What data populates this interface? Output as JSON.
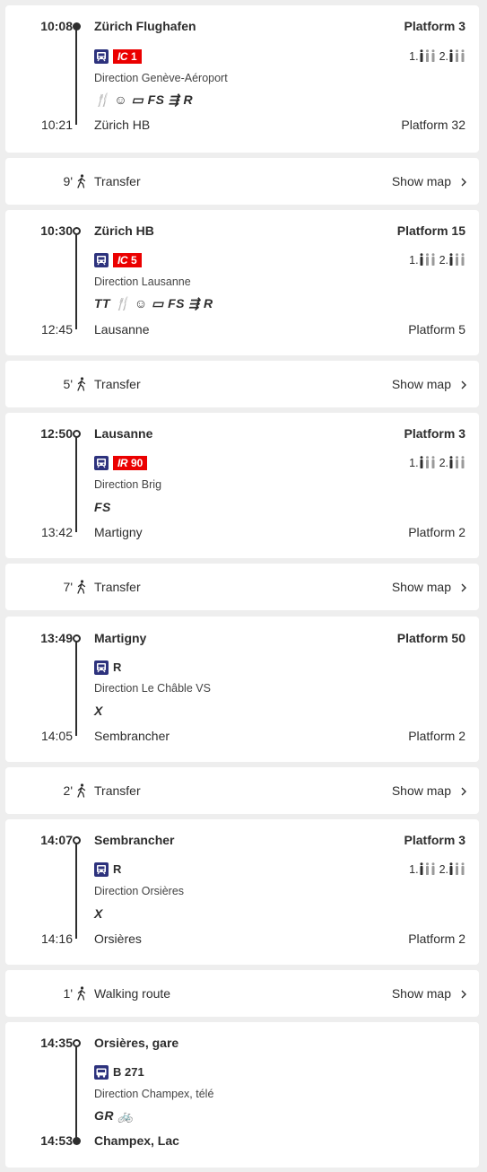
{
  "legs": [
    {
      "dep_time": "10:08",
      "dep_stop": "Zürich Flughafen",
      "dep_platform": "Platform 3",
      "line_prefix": "IC",
      "line_number": "1",
      "line_type": "red-badge",
      "occupancy": {
        "first": "1.",
        "second": "2."
      },
      "direction": "Direction Genève-Aéroport",
      "services": "🍴 ☺ ▭ FS ⇶ R",
      "arr_time": "10:21",
      "arr_stop": "Zürich HB",
      "arr_platform": "Platform 32"
    },
    {
      "dep_time": "10:30",
      "dep_stop": "Zürich HB",
      "dep_platform": "Platform 15",
      "line_prefix": "IC",
      "line_number": "5",
      "line_type": "red-badge",
      "occupancy": {
        "first": "1.",
        "second": "2."
      },
      "direction": "Direction Lausanne",
      "services": "TT 🍴 ☺ ▭ FS ⇶ R",
      "arr_time": "12:45",
      "arr_stop": "Lausanne",
      "arr_platform": "Platform 5"
    },
    {
      "dep_time": "12:50",
      "dep_stop": "Lausanne",
      "dep_platform": "Platform 3",
      "line_prefix": "IR",
      "line_number": "90",
      "line_type": "red-badge",
      "occupancy": {
        "first": "1.",
        "second": "2."
      },
      "direction": "Direction Brig",
      "services": "FS",
      "arr_time": "13:42",
      "arr_stop": "Martigny",
      "arr_platform": "Platform 2"
    },
    {
      "dep_time": "13:49",
      "dep_stop": "Martigny",
      "dep_platform": "Platform 50",
      "line_label": "R",
      "line_type": "train-text",
      "direction": "Direction Le Châble VS",
      "services": "X",
      "arr_time": "14:05",
      "arr_stop": "Sembrancher",
      "arr_platform": "Platform 2"
    },
    {
      "dep_time": "14:07",
      "dep_stop": "Sembrancher",
      "dep_platform": "Platform 3",
      "line_label": "R",
      "line_type": "train-text",
      "occupancy": {
        "first": "1.",
        "second": "2."
      },
      "direction": "Direction Orsières",
      "services": "X",
      "arr_time": "14:16",
      "arr_stop": "Orsières",
      "arr_platform": "Platform 2"
    },
    {
      "dep_time": "14:35",
      "dep_stop": "Orsières, gare",
      "dep_platform": "",
      "line_label": "B 271",
      "line_type": "bus-text",
      "direction": "Direction Champex, télé",
      "services": "GR 🚲",
      "arr_time": "14:53",
      "arr_stop": "Champex, Lac",
      "arr_platform": ""
    }
  ],
  "transfers": [
    {
      "minutes": "9'",
      "label": "Transfer",
      "action": "Show map"
    },
    {
      "minutes": "5'",
      "label": "Transfer",
      "action": "Show map"
    },
    {
      "minutes": "7'",
      "label": "Transfer",
      "action": "Show map"
    },
    {
      "minutes": "2'",
      "label": "Transfer",
      "action": "Show map"
    },
    {
      "minutes": "1'",
      "label": "Walking route",
      "action": "Show map"
    }
  ],
  "colors": {
    "accent_red": "#eb0000",
    "train_blue": "#2d327d",
    "text": "#2d2d2d",
    "background": "#eeeeee"
  },
  "icons": [
    "train-icon",
    "bus-icon",
    "walking-icon",
    "chevron-right-icon",
    "occupancy-icon"
  ]
}
